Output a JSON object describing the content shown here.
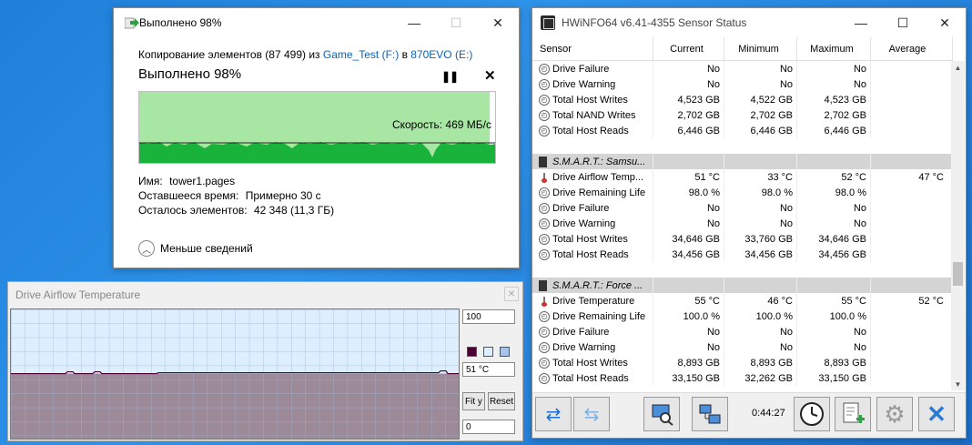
{
  "copy_dialog": {
    "title": "Выполнено 98%",
    "copy_prefix": "Копирование элементов (87 499) из ",
    "source": "Game_Test (F:)",
    "copy_mid": " в ",
    "dest": "870EVO (E:)",
    "status": "Выполнено 98%",
    "pause_glyph": "❚❚",
    "stop_glyph": "✕",
    "speed": "Скорость: 469 МБ/с",
    "name_label": "Имя:",
    "name_value": "tower1.pages",
    "time_label": "Оставшееся время:",
    "time_value": "Примерно 30 с",
    "items_label": "Осталось элементов:",
    "items_value": "42 348 (11,3 ГБ)",
    "less_details": "Меньше сведений",
    "progress_fraction": 0.98
  },
  "graph_window": {
    "title": "Drive Airflow Temperature",
    "max_value": "100",
    "current_value": "51 °C",
    "min_value": "0",
    "fit_label": "Fit y",
    "reset_label": "Reset",
    "swatch_colors": [
      "#4a0033",
      "#ddeeff",
      "#a8c4ea"
    ],
    "level_fraction": 0.51
  },
  "hwinfo": {
    "title": "HWiNFO64 v6.41-4355 Sensor Status",
    "columns": [
      "Sensor",
      "Current",
      "Minimum",
      "Maximum",
      "Average"
    ],
    "rows": [
      {
        "type": "item",
        "icon": "circle",
        "name": "Drive Failure",
        "cur": "No",
        "min": "No",
        "max": "No",
        "avg": ""
      },
      {
        "type": "item",
        "icon": "circle",
        "name": "Drive Warning",
        "cur": "No",
        "min": "No",
        "max": "No",
        "avg": ""
      },
      {
        "type": "item",
        "icon": "circle",
        "name": "Total Host Writes",
        "cur": "4,523 GB",
        "min": "4,522 GB",
        "max": "4,523 GB",
        "avg": ""
      },
      {
        "type": "item",
        "icon": "circle",
        "name": "Total NAND Writes",
        "cur": "2,702 GB",
        "min": "2,702 GB",
        "max": "2,702 GB",
        "avg": ""
      },
      {
        "type": "item",
        "icon": "circle",
        "name": "Total Host Reads",
        "cur": "6,446 GB",
        "min": "6,446 GB",
        "max": "6,446 GB",
        "avg": ""
      },
      {
        "type": "spacer"
      },
      {
        "type": "group",
        "name": "S.M.A.R.T.: Samsu..."
      },
      {
        "type": "item",
        "icon": "thermo",
        "name": "Drive Airflow Temp...",
        "cur": "51 °C",
        "min": "33 °C",
        "max": "52 °C",
        "avg": "47 °C"
      },
      {
        "type": "item",
        "icon": "circle",
        "name": "Drive Remaining Life",
        "cur": "98.0 %",
        "min": "98.0 %",
        "max": "98.0 %",
        "avg": ""
      },
      {
        "type": "item",
        "icon": "circle",
        "name": "Drive Failure",
        "cur": "No",
        "min": "No",
        "max": "No",
        "avg": ""
      },
      {
        "type": "item",
        "icon": "circle",
        "name": "Drive Warning",
        "cur": "No",
        "min": "No",
        "max": "No",
        "avg": ""
      },
      {
        "type": "item",
        "icon": "circle",
        "name": "Total Host Writes",
        "cur": "34,646 GB",
        "min": "33,760 GB",
        "max": "34,646 GB",
        "avg": ""
      },
      {
        "type": "item",
        "icon": "circle",
        "name": "Total Host Reads",
        "cur": "34,456 GB",
        "min": "34,456 GB",
        "max": "34,456 GB",
        "avg": ""
      },
      {
        "type": "spacer"
      },
      {
        "type": "group",
        "name": "S.M.A.R.T.: Force ..."
      },
      {
        "type": "item",
        "icon": "thermo",
        "name": "Drive Temperature",
        "cur": "55 °C",
        "min": "46 °C",
        "max": "55 °C",
        "avg": "52 °C"
      },
      {
        "type": "item",
        "icon": "circle",
        "name": "Drive Remaining Life",
        "cur": "100.0 %",
        "min": "100.0 %",
        "max": "100.0 %",
        "avg": ""
      },
      {
        "type": "item",
        "icon": "circle",
        "name": "Drive Failure",
        "cur": "No",
        "min": "No",
        "max": "No",
        "avg": ""
      },
      {
        "type": "item",
        "icon": "circle",
        "name": "Drive Warning",
        "cur": "No",
        "min": "No",
        "max": "No",
        "avg": ""
      },
      {
        "type": "item",
        "icon": "circle",
        "name": "Total Host Writes",
        "cur": "8,893 GB",
        "min": "8,893 GB",
        "max": "8,893 GB",
        "avg": ""
      },
      {
        "type": "item",
        "icon": "circle",
        "name": "Total Host Reads",
        "cur": "33,150 GB",
        "min": "32,262 GB",
        "max": "33,150 GB",
        "avg": ""
      }
    ],
    "elapsed": "0:44:27"
  }
}
